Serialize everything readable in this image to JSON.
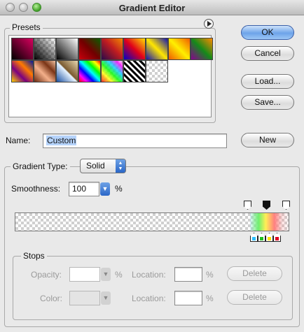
{
  "window": {
    "title": "Gradient Editor"
  },
  "presets": {
    "legend": "Presets",
    "menu_icon": "circle-arrow-icon"
  },
  "buttons": {
    "ok": "OK",
    "cancel": "Cancel",
    "load": "Load...",
    "save": "Save...",
    "new": "New"
  },
  "name_field": {
    "label": "Name:",
    "value": "Custom"
  },
  "gradient": {
    "type_label": "Gradient Type:",
    "type_value": "Solid",
    "smoothness_label": "Smoothness:",
    "smoothness_value": "100",
    "smoothness_unit": "%"
  },
  "stops": {
    "legend": "Stops",
    "opacity_label": "Opacity:",
    "opacity_unit": "%",
    "color_label": "Color:",
    "location_label": "Location:",
    "location_unit": "%",
    "delete_label": "Delete"
  },
  "colors": {
    "accent": "#3d82e0",
    "selection": "#b5d3fb"
  }
}
